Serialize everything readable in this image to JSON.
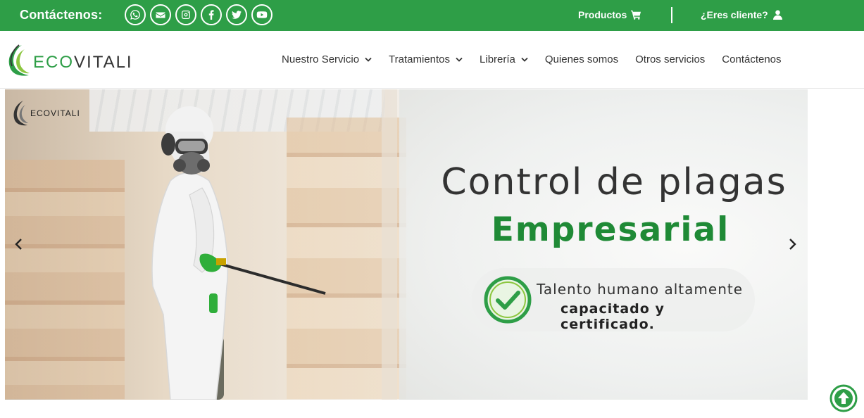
{
  "topbar": {
    "contact_label": "Contáctenos:",
    "social_icons": [
      "whatsapp-icon",
      "email-icon",
      "instagram-icon",
      "facebook-icon",
      "twitter-icon",
      "youtube-icon"
    ],
    "products_label": "Productos",
    "client_label": "¿Eres cliente?",
    "background": "#2e9e47"
  },
  "header": {
    "logo_eco": "ECO",
    "logo_vitali": "VITALI",
    "nav": [
      {
        "label": "Nuestro Servicio",
        "dropdown": true
      },
      {
        "label": "Tratamientos",
        "dropdown": true
      },
      {
        "label": "Librería",
        "dropdown": true
      },
      {
        "label": "Quienes somos",
        "dropdown": false
      },
      {
        "label": "Otros servicios",
        "dropdown": false
      },
      {
        "label": "Contáctenos",
        "dropdown": false
      }
    ]
  },
  "hero": {
    "logo_text": "ECOVITALI",
    "title": "Control de plagas",
    "subtitle": "Empresarial",
    "badge_line1": "Talento humano altamente",
    "badge_line2": "capacitado y certificado.",
    "accent_color": "#1f8a36"
  }
}
